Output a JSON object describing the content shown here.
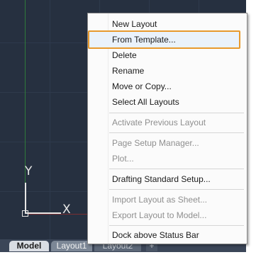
{
  "layout_tabs": [
    "Model",
    "Layout1",
    "Layout2",
    "+"
  ],
  "ucs": {
    "x_label": "X",
    "y_label": "Y"
  },
  "context_menu": {
    "items": [
      {
        "label": "New Layout",
        "enabled": true
      },
      {
        "label": "From Template...",
        "enabled": true,
        "highlighted": true
      },
      {
        "label": "Delete",
        "enabled": true
      },
      {
        "label": "Rename",
        "enabled": true
      },
      {
        "label": "Move or Copy...",
        "enabled": true
      },
      {
        "label": "Select All Layouts",
        "enabled": true
      },
      {
        "label": "Activate Previous Layout",
        "enabled": false
      },
      {
        "label": "Page Setup Manager...",
        "enabled": false
      },
      {
        "label": "Plot...",
        "enabled": false
      },
      {
        "label": "Drafting Standard Setup...",
        "enabled": true
      },
      {
        "label": "Import Layout as Sheet...",
        "enabled": false
      },
      {
        "label": "Export Layout to Model...",
        "enabled": false
      },
      {
        "label": "Dock above Status Bar",
        "enabled": true
      }
    ]
  },
  "colors": {
    "canvas_bg": "#263040",
    "highlight_border": "#e89a2e",
    "menu_bg": "#fbfbfb",
    "disabled_text": "#8f8f8f"
  }
}
